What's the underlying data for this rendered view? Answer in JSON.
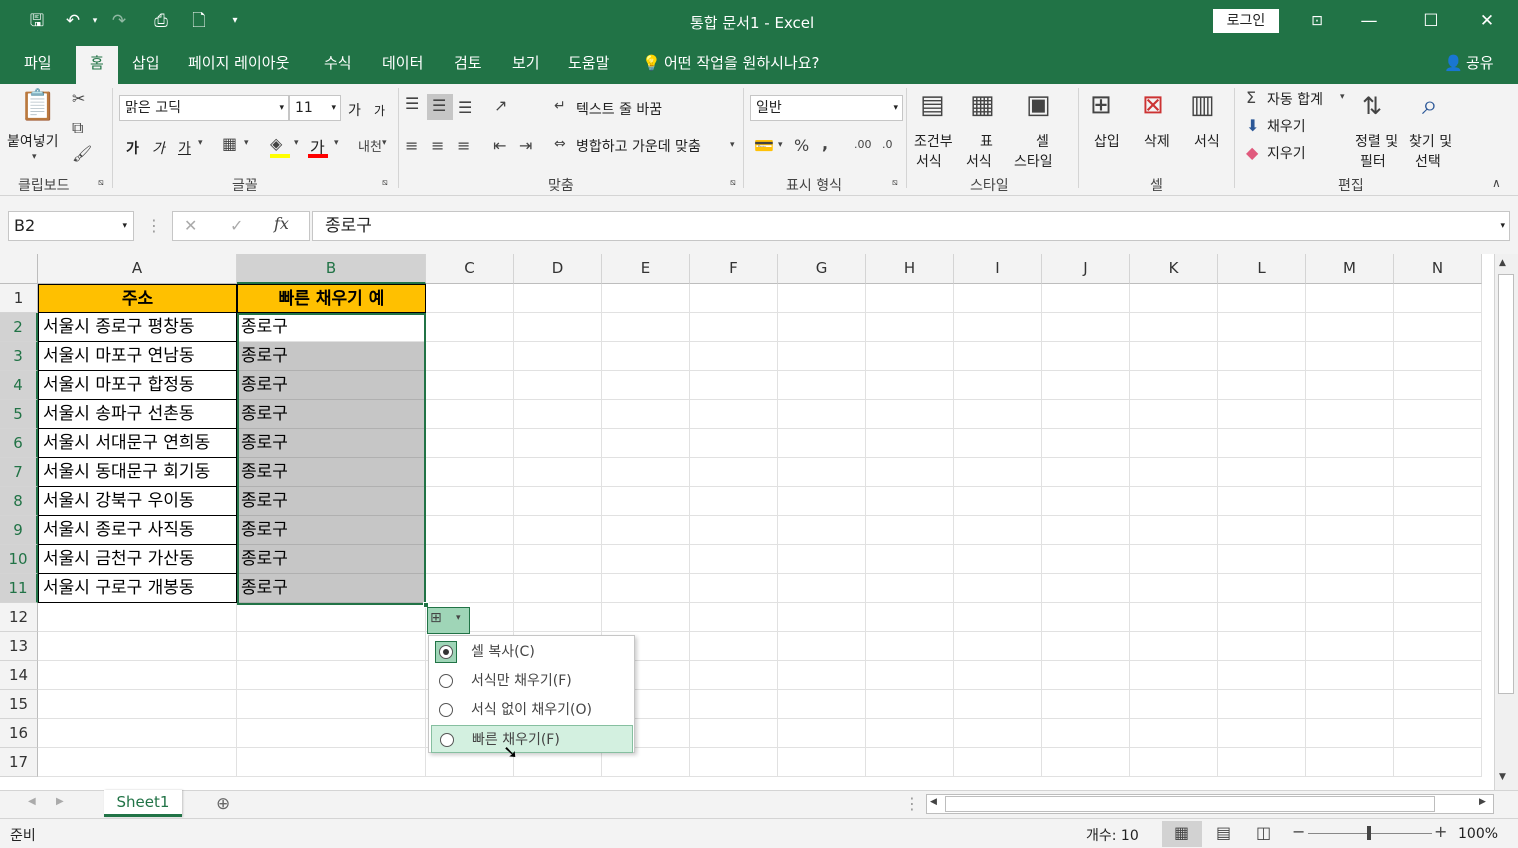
{
  "window": {
    "title": "통합 문서1  -  Excel",
    "login_label": "로그인"
  },
  "tabs": [
    "파일",
    "홈",
    "삽입",
    "페이지 레이아웃",
    "수식",
    "데이터",
    "검토",
    "보기",
    "도움말"
  ],
  "tell_me": "어떤 작업을 원하시나요?",
  "share_label": "공유",
  "ribbon": {
    "clipboard": {
      "paste": "붙여넣기",
      "label": "클립보드"
    },
    "font": {
      "name": "맑은 고딕",
      "size": "11",
      "label": "글꼴",
      "bold": "가",
      "italic": "가",
      "underline": "가",
      "grow": "가",
      "shrink": "가"
    },
    "align": {
      "wrap": "텍스트 줄 바꿈",
      "merge": "병합하고 가운데 맞춤",
      "label": "맞춤"
    },
    "number": {
      "format": "일반",
      "label": "표시 형식"
    },
    "styles": {
      "cond_line1": "조건부",
      "cond_line2": "서식",
      "table_line1": "표",
      "table_line2": "서식",
      "cell_line1": "셀",
      "cell_line2": "스타일",
      "label": "스타일"
    },
    "cells": {
      "insert": "삽입",
      "delete": "삭제",
      "format": "서식",
      "label": "셀"
    },
    "editing": {
      "autosum": "자동 합계",
      "fill": "채우기",
      "clear": "지우기",
      "sort_line1": "정렬 및",
      "sort_line2": "필터",
      "find_line1": "찾기 및",
      "find_line2": "선택",
      "label": "편집"
    }
  },
  "formula_bar": {
    "name_box": "B2",
    "formula": "종로구"
  },
  "columns": [
    "A",
    "B",
    "C",
    "D",
    "E",
    "F",
    "G",
    "H",
    "I",
    "J",
    "K",
    "L",
    "M",
    "N"
  ],
  "rows": [
    "1",
    "2",
    "3",
    "4",
    "5",
    "6",
    "7",
    "8",
    "9",
    "10",
    "11",
    "12",
    "13",
    "14",
    "15",
    "16",
    "17"
  ],
  "cells": {
    "header_a": "주소",
    "header_b": "빠른 채우기 예",
    "col_a": [
      "서울시 종로구 평창동",
      "서울시 마포구 연남동",
      "서울시 마포구 합정동",
      "서울시 송파구 선촌동",
      "서울시 서대문구 연희동",
      "서울시 동대문구 회기동",
      "서울시 강북구 우이동",
      "서울시 종로구 사직동",
      "서울시 금천구 가산동",
      "서울시 구로구 개봉동"
    ],
    "col_b": [
      "종로구",
      "종로구",
      "종로구",
      "종로구",
      "종로구",
      "종로구",
      "종로구",
      "종로구",
      "종로구",
      "종로구"
    ]
  },
  "autofill_menu": {
    "items": [
      "셀 복사(C)",
      "서식만 채우기(F)",
      "서식 없이 채우기(O)",
      "빠른 채우기(F)"
    ],
    "selected_index": 0,
    "hover_index": 3
  },
  "sheet_tab": "Sheet1",
  "status": {
    "ready": "준비",
    "count": "개수: 10",
    "zoom": "100%"
  },
  "colors": {
    "brand": "#217346",
    "header_fill": "#ffc000",
    "selection_fill": "#c6c6c6"
  }
}
